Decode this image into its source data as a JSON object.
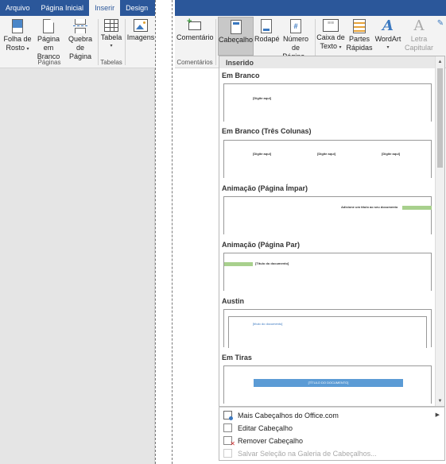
{
  "left_window": {
    "tabs": [
      {
        "label": "Arquivo",
        "active": false
      },
      {
        "label": "Página Inicial",
        "active": false
      },
      {
        "label": "Inserir",
        "active": true
      },
      {
        "label": "Design",
        "active": false
      }
    ],
    "buttons": {
      "cover": {
        "line1": "Folha de",
        "line2": "Rosto"
      },
      "blank": {
        "line1": "Página em",
        "line2": "Branco"
      },
      "break": {
        "line1": "Quebra",
        "line2": "de Página"
      },
      "table": {
        "line1": "Tabela"
      },
      "images": {
        "line1": "Imagens"
      }
    },
    "groups": {
      "pages": "Páginas",
      "tables": "Tabelas"
    }
  },
  "right_window": {
    "buttons": {
      "comment": {
        "line1": "Comentário"
      },
      "header": {
        "line1": "Cabeçalho"
      },
      "footer": {
        "line1": "Rodapé"
      },
      "page_number": {
        "line1": "Número de",
        "line2": "Página"
      },
      "textbox": {
        "line1": "Caixa de",
        "line2": "Texto"
      },
      "quick_parts": {
        "line1": "Partes",
        "line2": "Rápidas"
      },
      "wordart": {
        "line1": "WordArt"
      },
      "dropcap": {
        "line1": "Letra",
        "line2": "Capitular"
      }
    },
    "groups": {
      "comments": "Comentários"
    }
  },
  "gallery": {
    "section": "Inserido",
    "items": [
      {
        "title": "Em Branco",
        "preview_text": [
          "[Digite aqui]"
        ]
      },
      {
        "title": "Em Branco (Três Colunas)",
        "preview_text": [
          "[Digite aqui]",
          "[Digite aqui]",
          "[Digite aqui]"
        ]
      },
      {
        "title": "Animação (Página Ímpar)",
        "preview_text": [
          "Adicione um título ao seu documento"
        ]
      },
      {
        "title": "Animação (Página Par)",
        "preview_text": [
          "[Título do documento]"
        ]
      },
      {
        "title": "Austin",
        "preview_text": [
          "[título do documento]"
        ]
      },
      {
        "title": "Em Tiras",
        "preview_text": [
          "[TÍTULO DO DOCUMENTO]"
        ]
      }
    ]
  },
  "menu": {
    "items": [
      {
        "label": "Mais Cabeçalhos do Office.com",
        "enabled": true,
        "submenu": true
      },
      {
        "label": "Editar Cabeçalho",
        "enabled": true,
        "submenu": false
      },
      {
        "label": "Remover Cabeçalho",
        "enabled": true,
        "submenu": false
      },
      {
        "label": "Salvar Seleção na Galeria de Cabeçalhos...",
        "enabled": false,
        "submenu": false
      }
    ]
  },
  "colors": {
    "title_bar": "#2b579a",
    "accent_green": "#a8d08d",
    "accent_blue": "#5b9bd5"
  }
}
